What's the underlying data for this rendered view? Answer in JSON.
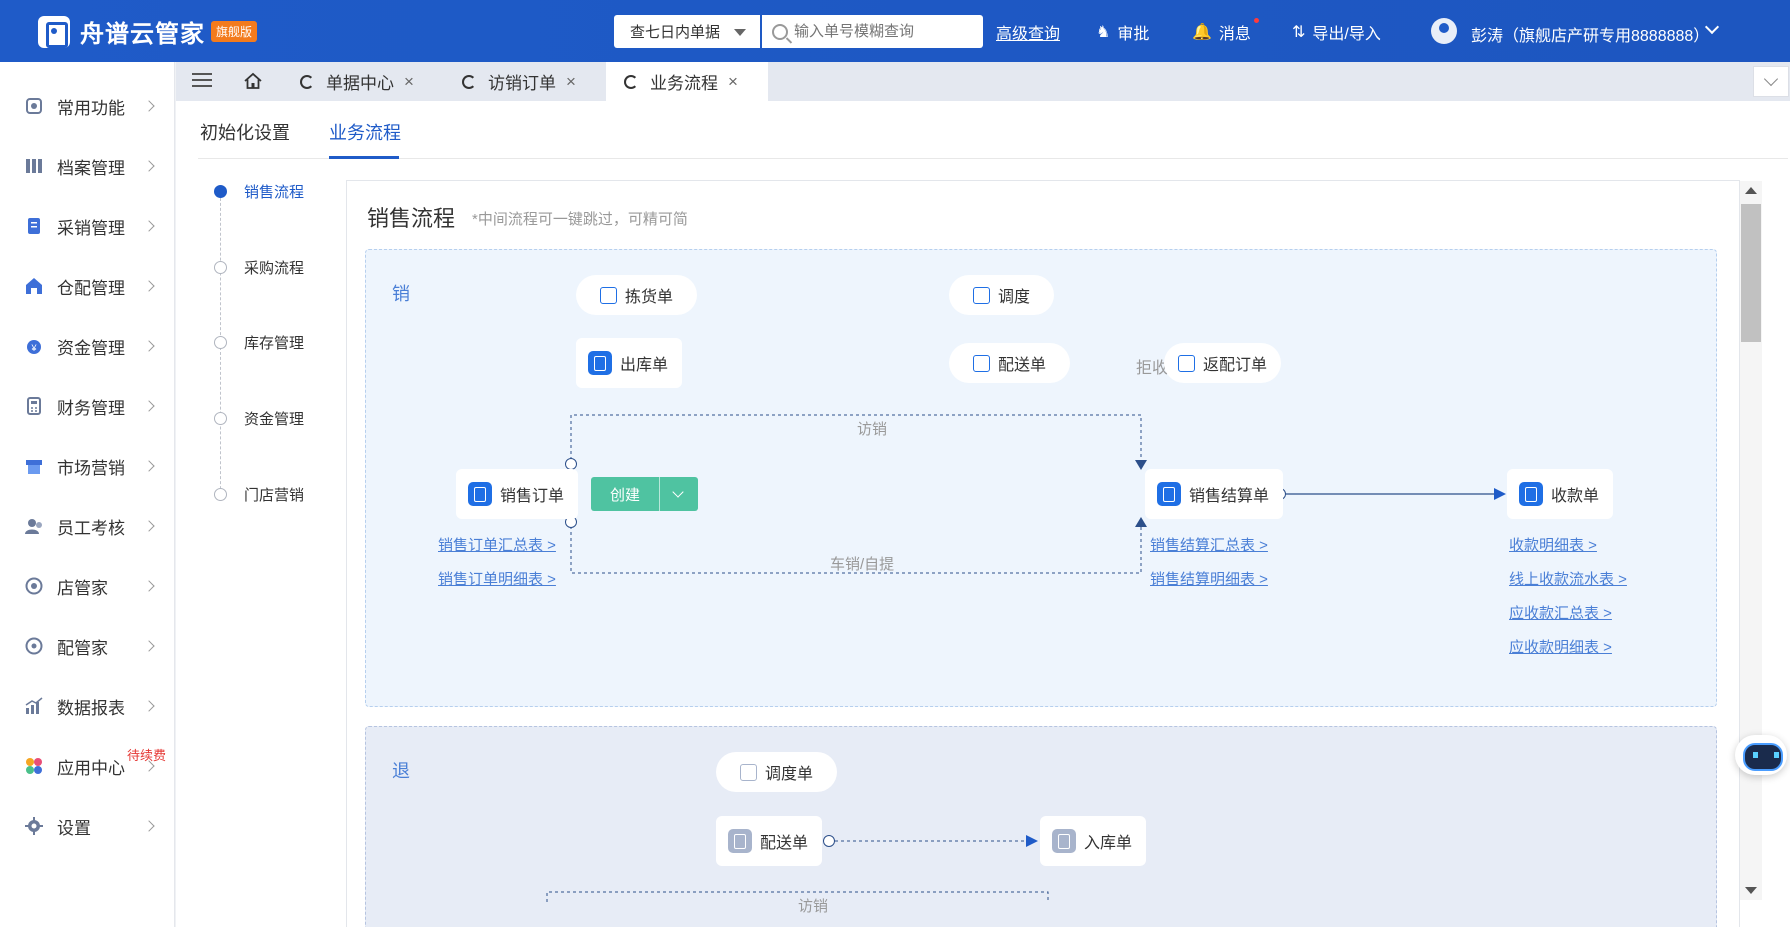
{
  "app": {
    "name": "舟谱云管家",
    "edition": "旗舰版"
  },
  "header": {
    "filter_value": "查七日内单据",
    "search_placeholder": "输入单号模糊查询",
    "advanced_search": "高级查询",
    "approve": "审批",
    "messages": "消息",
    "import_export": "导出/导入",
    "user": "彭涛（旗舰店产研专用8888888）"
  },
  "sidebar": {
    "items": [
      {
        "label": "常用功能",
        "icon": "common-icon"
      },
      {
        "label": "档案管理",
        "icon": "archive-icon"
      },
      {
        "label": "采销管理",
        "icon": "purchase-sale-icon"
      },
      {
        "label": "仓配管理",
        "icon": "warehouse-icon"
      },
      {
        "label": "资金管理",
        "icon": "funds-icon"
      },
      {
        "label": "财务管理",
        "icon": "finance-icon"
      },
      {
        "label": "市场营销",
        "icon": "marketing-icon"
      },
      {
        "label": "员工考核",
        "icon": "staff-icon"
      },
      {
        "label": "店管家",
        "icon": "store-icon"
      },
      {
        "label": "配管家",
        "icon": "delivery-icon"
      },
      {
        "label": "数据报表",
        "icon": "report-icon"
      },
      {
        "label": "应用中心",
        "icon": "apps-icon",
        "badge": "待续费"
      },
      {
        "label": "设置",
        "icon": "settings-icon"
      }
    ]
  },
  "tabs": [
    {
      "label": "单据中心"
    },
    {
      "label": "访销订单"
    },
    {
      "label": "业务流程"
    }
  ],
  "subtabs": [
    "初始化设置",
    "业务流程"
  ],
  "steps": [
    "销售流程",
    "采购流程",
    "库存管理",
    "资金管理",
    "门店营销"
  ],
  "panel": {
    "title": "销售流程",
    "subtitle": "*中间流程可一键跳过，可精可简"
  },
  "sell": {
    "zone_label": "销",
    "picking": "拣货单",
    "dispatch": "调度",
    "outbound": "出库单",
    "delivery": "配送单",
    "reject": "拒收",
    "return_delivery": "返配订单",
    "sales_order": "销售订单",
    "create": "创建",
    "visit_sale": "访销",
    "car_sale": "车销/自提",
    "settlement": "销售结算单",
    "receipt": "收款单",
    "links_order": [
      "销售订单汇总表 >",
      "销售订单明细表 >"
    ],
    "links_settlement": [
      "销售结算汇总表 >",
      "销售结算明细表 >"
    ],
    "links_receipt": [
      "收款明细表 >",
      "线上收款流水表 >",
      "应收款汇总表 >",
      "应收款明细表 >"
    ]
  },
  "return": {
    "zone_label": "退",
    "dispatch": "调度单",
    "delivery": "配送单",
    "inbound": "入库单",
    "visit_sale": "访销"
  },
  "colors": {
    "primary": "#1f5bc8",
    "create_button": "#4fc3a1",
    "link": "#4a7fd6",
    "badge_red": "#e53935",
    "edition_badge": "#f37b1d"
  }
}
